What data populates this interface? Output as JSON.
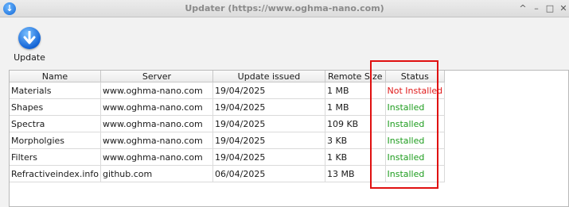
{
  "window": {
    "title": "Updater (https://www.oghma-nano.com)",
    "controls": [
      "^",
      "–",
      "□",
      "✕"
    ]
  },
  "toolbar": {
    "update_label": "Update"
  },
  "table": {
    "columns": [
      "Name",
      "Server",
      "Update issued",
      "Remote Size",
      "Status"
    ],
    "rows": [
      {
        "name": "Materials",
        "server": "www.oghma-nano.com",
        "issued": "19/04/2025",
        "size": "1 MB",
        "status": "Not Installed",
        "status_kind": "not-installed"
      },
      {
        "name": "Shapes",
        "server": "www.oghma-nano.com",
        "issued": "19/04/2025",
        "size": "1 MB",
        "status": "Installed",
        "status_kind": "installed"
      },
      {
        "name": "Spectra",
        "server": "www.oghma-nano.com",
        "issued": "19/04/2025",
        "size": "109 KB",
        "status": "Installed",
        "status_kind": "installed"
      },
      {
        "name": "Morpholgies",
        "server": "www.oghma-nano.com",
        "issued": "19/04/2025",
        "size": "3 KB",
        "status": "Installed",
        "status_kind": "installed"
      },
      {
        "name": "Filters",
        "server": "www.oghma-nano.com",
        "issued": "19/04/2025",
        "size": "1 KB",
        "status": "Installed",
        "status_kind": "installed"
      },
      {
        "name": "Refractiveindex.info",
        "server": "github.com",
        "issued": "06/04/2025",
        "size": "13 MB",
        "status": "Installed",
        "status_kind": "installed"
      }
    ]
  },
  "colors": {
    "installed": "#1e9d1e",
    "not_installed": "#e01b1b",
    "highlight": "#e01010",
    "accent": "#1565d6"
  },
  "icons": {
    "app": "download-arrow-icon",
    "update": "download-arrow-icon"
  }
}
